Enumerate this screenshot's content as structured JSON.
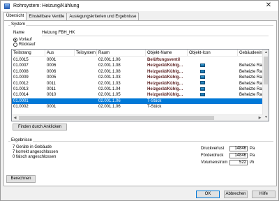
{
  "window": {
    "title": "Rohrsystem: Heizung/Kühlung",
    "close_glyph": "✕"
  },
  "tabs": [
    {
      "label": "Übersicht",
      "active": true
    },
    {
      "label": "Einstellbare Ventile",
      "active": false
    },
    {
      "label": "Auslegungskriterien und Ergebnisse",
      "active": false
    }
  ],
  "system": {
    "group_label": "System",
    "name_label": "Name",
    "name_value": "Heizung FBH_HK",
    "radios": [
      {
        "label": "Vorlauf",
        "selected": true
      },
      {
        "label": "Rücklauf",
        "selected": false
      }
    ]
  },
  "table": {
    "headers": [
      "Teilstrang",
      "Aus",
      "Teilsystem",
      "Raum",
      "Objekt-Name",
      "Objekt-Icon",
      "Gebäudeeinh"
    ],
    "rows": [
      {
        "cells": [
          "01.0015",
          "0001",
          "",
          "02.001.1.06",
          "Belüftungsventil",
          "",
          ""
        ],
        "bold": true,
        "icon": false,
        "selected": false
      },
      {
        "cells": [
          "01.0007",
          "0006",
          "",
          "02.001.1.08",
          "Heizgerät/Kühlg…",
          "",
          "Beheizte Rau"
        ],
        "bold": true,
        "icon": true,
        "selected": false
      },
      {
        "cells": [
          "01.0008",
          "0006",
          "",
          "02.001.1.08",
          "Heizgerät/Kühlg…",
          "",
          "Beheizte Rau"
        ],
        "bold": true,
        "icon": true,
        "selected": false
      },
      {
        "cells": [
          "01.0009",
          "0005",
          "",
          "02.001.1.03",
          "Heizgerät/Kühlg…",
          "",
          "Beheizte Rau"
        ],
        "bold": true,
        "icon": true,
        "selected": false
      },
      {
        "cells": [
          "01.0012",
          "0011",
          "",
          "02.001.1.03",
          "Heizgerät/Kühlg…",
          "",
          "Beheizte Rau"
        ],
        "bold": true,
        "icon": true,
        "selected": false
      },
      {
        "cells": [
          "01.0013",
          "0011",
          "",
          "02.001.1.04",
          "Heizgerät/Kühlg…",
          "",
          "Beheizte Rau"
        ],
        "bold": true,
        "icon": true,
        "selected": false
      },
      {
        "cells": [
          "01.0014",
          "0010",
          "",
          "02.001.1.05",
          "Heizgerät/Kühlg…",
          "",
          "Beheizte Rau"
        ],
        "bold": true,
        "icon": true,
        "selected": false
      },
      {
        "cells": [
          "01.0001",
          "",
          "",
          "02.001.1.06",
          "T-Stück",
          "",
          ""
        ],
        "bold": false,
        "icon": false,
        "selected": true
      },
      {
        "cells": [
          "01.0002",
          "0001",
          "",
          "02.001.1.06",
          "T-Stück",
          "",
          ""
        ],
        "bold": false,
        "icon": false,
        "selected": false
      }
    ],
    "scroll_up": "▲",
    "scroll_down": "▼",
    "scroll_left": "◀",
    "scroll_right": "▶"
  },
  "find_button": "Finden durch Anklicken",
  "results": {
    "group_label": "Ergebnisse",
    "lines": [
      "7 Geräte in Gebäude",
      "7 korrekt angeschlossen",
      "0 falsch angeschlossen"
    ],
    "values": [
      {
        "label": "Druckverlust",
        "value": "14846",
        "unit": "Pa"
      },
      {
        "label": "Förderdruck",
        "value": "14846",
        "unit": "Pa"
      },
      {
        "label": "Volumenstrom",
        "value": "522",
        "unit": "l/h"
      }
    ]
  },
  "buttons": {
    "calc": "Berechnen",
    "ok": "OK",
    "cancel": "Abbrechen",
    "help": "Hilfe"
  }
}
